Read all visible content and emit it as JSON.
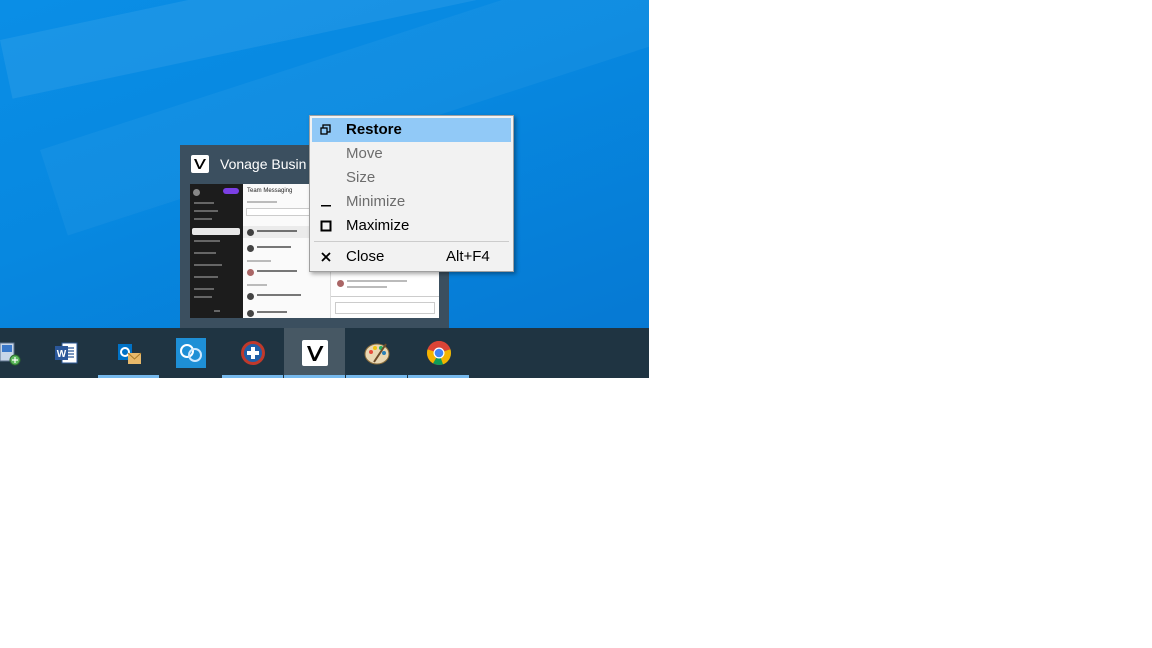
{
  "desktop": {
    "background_color": "#0788e0"
  },
  "thumbnail": {
    "title": "Vonage Busin",
    "logo_icon": "vonage-logo-icon",
    "preview_heading": "Team Messaging"
  },
  "context_menu": {
    "items": [
      {
        "label": "Restore",
        "icon": "restore-icon",
        "state": "highlighted"
      },
      {
        "label": "Move",
        "icon": "",
        "state": "disabled"
      },
      {
        "label": "Size",
        "icon": "",
        "state": "disabled"
      },
      {
        "label": "Minimize",
        "icon": "minimize-icon",
        "state": "disabled"
      },
      {
        "label": "Maximize",
        "icon": "maximize-icon",
        "state": "enabled"
      },
      {
        "label": "Close",
        "icon": "close-icon",
        "state": "enabled",
        "accelerator": "Alt+F4"
      }
    ]
  },
  "taskbar": {
    "background_color": "#1f3442",
    "items": [
      {
        "name": "network-icon",
        "active": false,
        "running": false
      },
      {
        "name": "microsoft-word-icon",
        "active": false,
        "running": false
      },
      {
        "name": "microsoft-outlook-icon",
        "active": false,
        "running": true
      },
      {
        "name": "remote-support-icon",
        "active": false,
        "running": false
      },
      {
        "name": "medical-plus-icon",
        "active": false,
        "running": true
      },
      {
        "name": "vonage-business-icon",
        "active": true,
        "running": true
      },
      {
        "name": "paint-palette-icon",
        "active": false,
        "running": true
      },
      {
        "name": "google-chrome-icon",
        "active": false,
        "running": true
      }
    ]
  }
}
